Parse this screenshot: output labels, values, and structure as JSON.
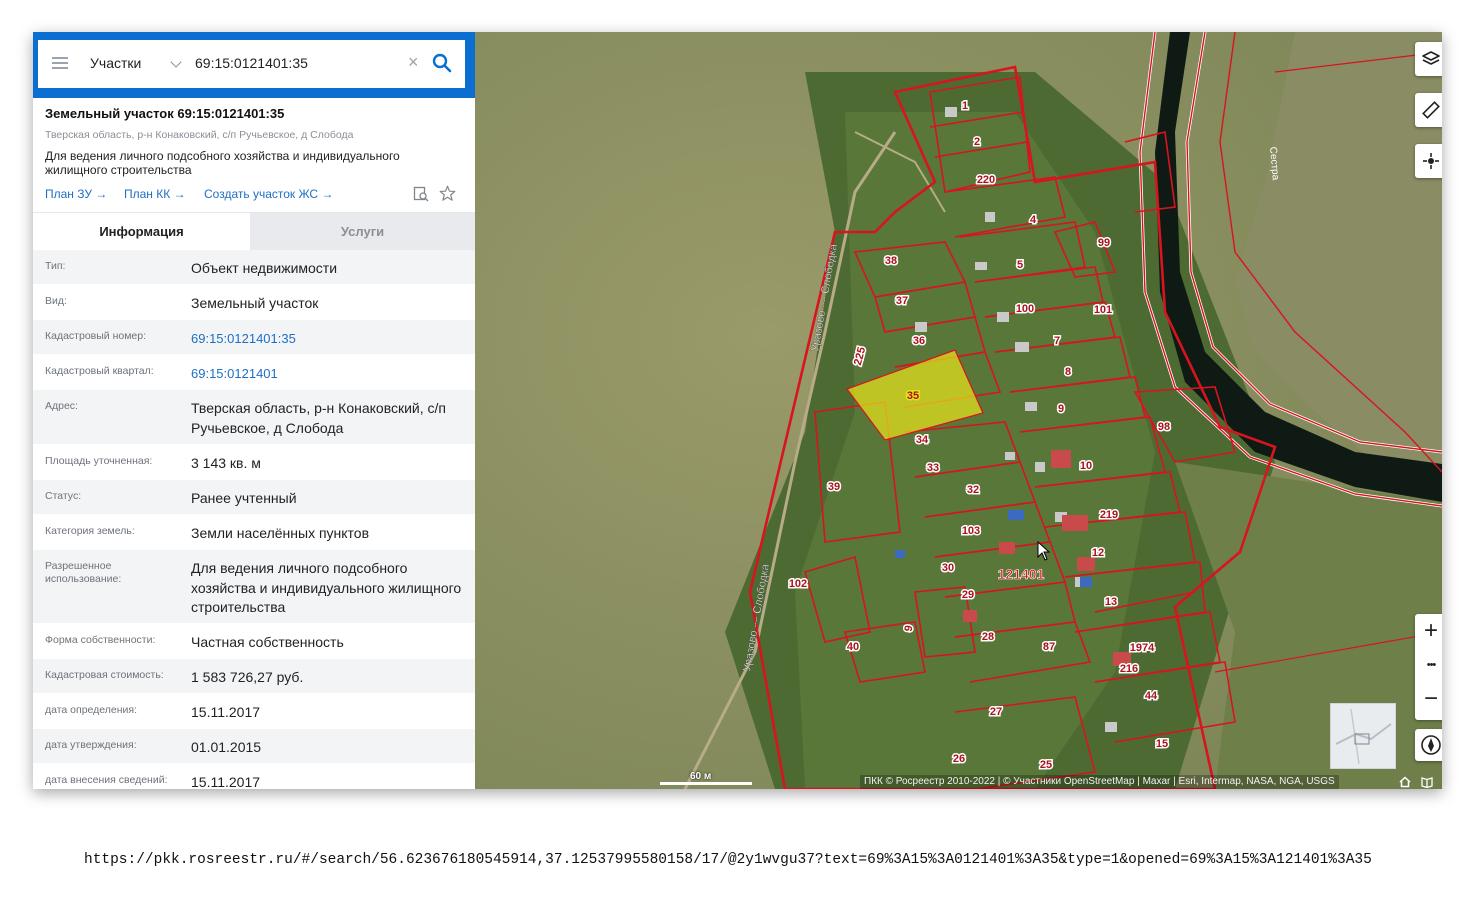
{
  "search": {
    "category": "Участки",
    "query": "69:15:0121401:35",
    "clear_icon": "close-icon",
    "search_icon": "search-icon"
  },
  "object": {
    "title": "Земельный участок 69:15:0121401:35",
    "address": "Тверская область, р-н Конаковский, с/п Ручьевское, д Слобода",
    "purpose": "Для ведения личного подсобного хозяйства и индивидуального жилищного строительства",
    "links": [
      "План ЗУ",
      "План КК",
      "Создать участок ЖС"
    ],
    "link_arrow": "→"
  },
  "tabs": [
    "Информация",
    "Услуги"
  ],
  "info_rows": [
    {
      "label": "Тип:",
      "value": "Объект недвижимости"
    },
    {
      "label": "Вид:",
      "value": "Земельный участок"
    },
    {
      "label": "Кадастровый номер:",
      "value": "69:15:0121401:35"
    },
    {
      "label": "Кадастровый квартал:",
      "value": "69:15:0121401"
    },
    {
      "label": "Адрес:",
      "value": "Тверская область, р-н Конаковский, с/п Ручьевское, д Слобода"
    },
    {
      "label": "Площадь уточненная:",
      "value": "3 143 кв. м"
    },
    {
      "label": "Статус:",
      "value": "Ранее учтенный"
    },
    {
      "label": "Категория земель:",
      "value": "Земли населённых пунктов"
    },
    {
      "label": "Разрешенное использование:",
      "value": "Для ведения личного подсобного хозяйства и индивидуального жилищного строительства"
    },
    {
      "label": "Форма собственности:",
      "value": "Частная собственность"
    },
    {
      "label": "Кадастровая стоимость:",
      "value": "1 583 726,27 руб."
    },
    {
      "label": "дата определения:",
      "value": "15.11.2017"
    },
    {
      "label": "дата утверждения:",
      "value": "01.01.2015"
    },
    {
      "label": "дата внесения сведений:",
      "value": "15.11.2017"
    }
  ],
  "map": {
    "road_label": "Уразово — Слободка",
    "river_label": "Сестра",
    "quarter_label": "121401",
    "scale_label": "60 м",
    "attribution": "ПКК © Росреестр 2010-2022 | © Участники OpenStreetMap | Maxar | Esri, Intermap, NASA, NGA, USGS",
    "controls": [
      "layers-icon",
      "ruler-icon",
      "locate-icon",
      "zoom-in",
      "more",
      "zoom-out",
      "compass-icon"
    ],
    "zoom_in": "+",
    "zoom_more": "•••",
    "zoom_out": "−",
    "plot_numbers": [
      "1",
      "2",
      "220",
      "4",
      "99",
      "5",
      "38",
      "37",
      "100",
      "101",
      "225",
      "36",
      "7",
      "35",
      "8",
      "9",
      "98",
      "34",
      "10",
      "33",
      "39",
      "32",
      "219",
      "103",
      "12",
      "102",
      "30",
      "121401",
      "29",
      "13",
      "28",
      "87",
      "40",
      "1974",
      "216",
      "44",
      "27",
      "15",
      "26",
      "25",
      "9"
    ]
  },
  "browser": {
    "url": "https://pkk.rosreestr.ru/#/search/56.623676180545914,37.12537995580158/17/@2y1wvgu37?text=69%3A15%3A0121401%3A35&type=1&opened=69%3A15%3A121401%3A35"
  },
  "colors": {
    "accent": "#0b6fd1",
    "link": "#1d6fc4",
    "boundary": "#d8141f",
    "selected_plot": "#e6e21c"
  }
}
